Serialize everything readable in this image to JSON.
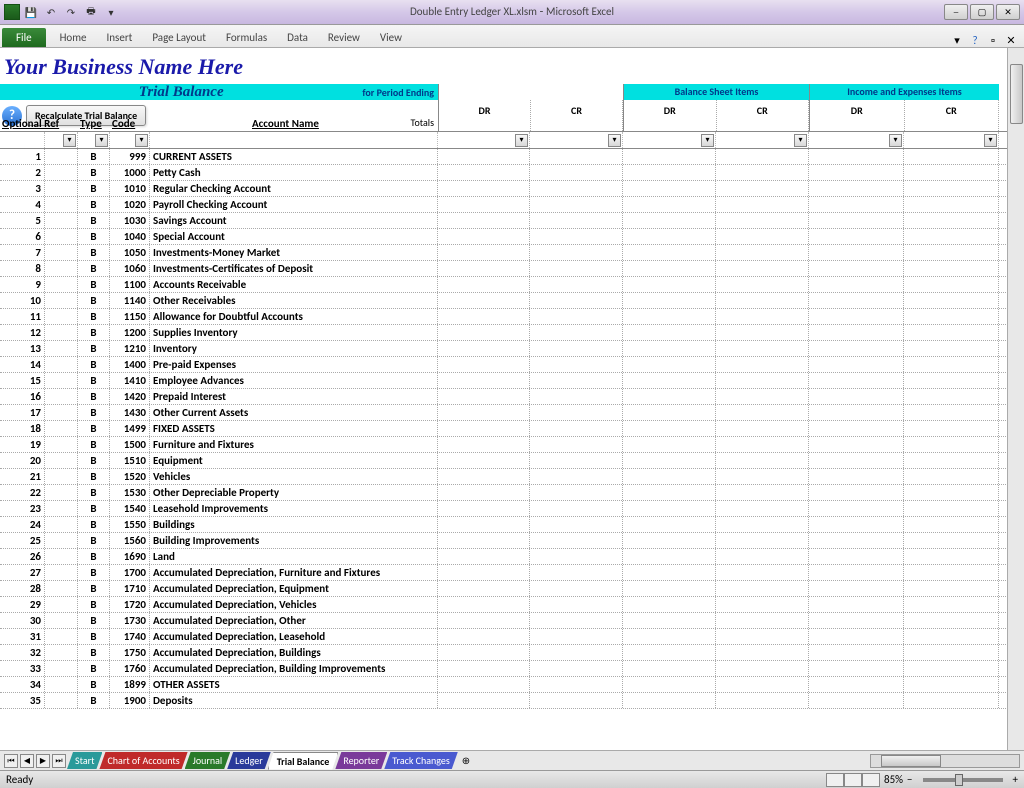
{
  "titlebar": {
    "filename": "Double Entry Ledger XL.xlsm",
    "app": "Microsoft Excel"
  },
  "ribbon": {
    "file": "File",
    "tabs": [
      "Home",
      "Insert",
      "Page Layout",
      "Formulas",
      "Data",
      "Review",
      "View"
    ]
  },
  "business_title": "Your Business Name Here",
  "header": {
    "trial": "Trial Balance",
    "period": "for Period Ending",
    "balance": "Balance Sheet Items",
    "income": "Income and Expenses Items",
    "dr": "DR",
    "cr": "CR",
    "totals": "Totals"
  },
  "buttons": {
    "recalc": "Recalculate Trial Balance"
  },
  "col_labels": {
    "ref": "Optional Ref",
    "type": "Type",
    "code": "Code",
    "acct": "Account Name"
  },
  "rows": [
    {
      "n": "1",
      "t": "B",
      "c": "999",
      "a": "CURRENT ASSETS"
    },
    {
      "n": "2",
      "t": "B",
      "c": "1000",
      "a": "Petty Cash"
    },
    {
      "n": "3",
      "t": "B",
      "c": "1010",
      "a": "Regular Checking Account"
    },
    {
      "n": "4",
      "t": "B",
      "c": "1020",
      "a": "Payroll Checking Account"
    },
    {
      "n": "5",
      "t": "B",
      "c": "1030",
      "a": "Savings Account"
    },
    {
      "n": "6",
      "t": "B",
      "c": "1040",
      "a": "Special Account"
    },
    {
      "n": "7",
      "t": "B",
      "c": "1050",
      "a": "Investments-Money Market"
    },
    {
      "n": "8",
      "t": "B",
      "c": "1060",
      "a": "Investments-Certificates of Deposit"
    },
    {
      "n": "9",
      "t": "B",
      "c": "1100",
      "a": "Accounts Receivable"
    },
    {
      "n": "10",
      "t": "B",
      "c": "1140",
      "a": "Other Receivables"
    },
    {
      "n": "11",
      "t": "B",
      "c": "1150",
      "a": "Allowance for Doubtful Accounts"
    },
    {
      "n": "12",
      "t": "B",
      "c": "1200",
      "a": "Supplies Inventory"
    },
    {
      "n": "13",
      "t": "B",
      "c": "1210",
      "a": "Inventory"
    },
    {
      "n": "14",
      "t": "B",
      "c": "1400",
      "a": "Pre-paid Expenses"
    },
    {
      "n": "15",
      "t": "B",
      "c": "1410",
      "a": "Employee Advances"
    },
    {
      "n": "16",
      "t": "B",
      "c": "1420",
      "a": "Prepaid Interest"
    },
    {
      "n": "17",
      "t": "B",
      "c": "1430",
      "a": "Other Current Assets"
    },
    {
      "n": "18",
      "t": "B",
      "c": "1499",
      "a": "FIXED ASSETS"
    },
    {
      "n": "19",
      "t": "B",
      "c": "1500",
      "a": "Furniture and Fixtures"
    },
    {
      "n": "20",
      "t": "B",
      "c": "1510",
      "a": "Equipment"
    },
    {
      "n": "21",
      "t": "B",
      "c": "1520",
      "a": "Vehicles"
    },
    {
      "n": "22",
      "t": "B",
      "c": "1530",
      "a": "Other Depreciable Property"
    },
    {
      "n": "23",
      "t": "B",
      "c": "1540",
      "a": "Leasehold Improvements"
    },
    {
      "n": "24",
      "t": "B",
      "c": "1550",
      "a": "Buildings"
    },
    {
      "n": "25",
      "t": "B",
      "c": "1560",
      "a": "Building Improvements"
    },
    {
      "n": "26",
      "t": "B",
      "c": "1690",
      "a": "Land"
    },
    {
      "n": "27",
      "t": "B",
      "c": "1700",
      "a": "Accumulated Depreciation, Furniture and Fixtures"
    },
    {
      "n": "28",
      "t": "B",
      "c": "1710",
      "a": "Accumulated Depreciation, Equipment"
    },
    {
      "n": "29",
      "t": "B",
      "c": "1720",
      "a": "Accumulated Depreciation, Vehicles"
    },
    {
      "n": "30",
      "t": "B",
      "c": "1730",
      "a": "Accumulated Depreciation, Other"
    },
    {
      "n": "31",
      "t": "B",
      "c": "1740",
      "a": "Accumulated Depreciation, Leasehold"
    },
    {
      "n": "32",
      "t": "B",
      "c": "1750",
      "a": "Accumulated Depreciation, Buildings"
    },
    {
      "n": "33",
      "t": "B",
      "c": "1760",
      "a": "Accumulated Depreciation, Building Improvements"
    },
    {
      "n": "34",
      "t": "B",
      "c": "1899",
      "a": "OTHER ASSETS"
    },
    {
      "n": "35",
      "t": "B",
      "c": "1900",
      "a": "Deposits"
    }
  ],
  "tabs": {
    "start": "Start",
    "chart": "Chart of Accounts",
    "journal": "Journal",
    "ledger": "Ledger",
    "trial": "Trial Balance",
    "reporter": "Reporter",
    "track": "Track Changes"
  },
  "status": {
    "ready": "Ready",
    "zoom": "85%"
  }
}
